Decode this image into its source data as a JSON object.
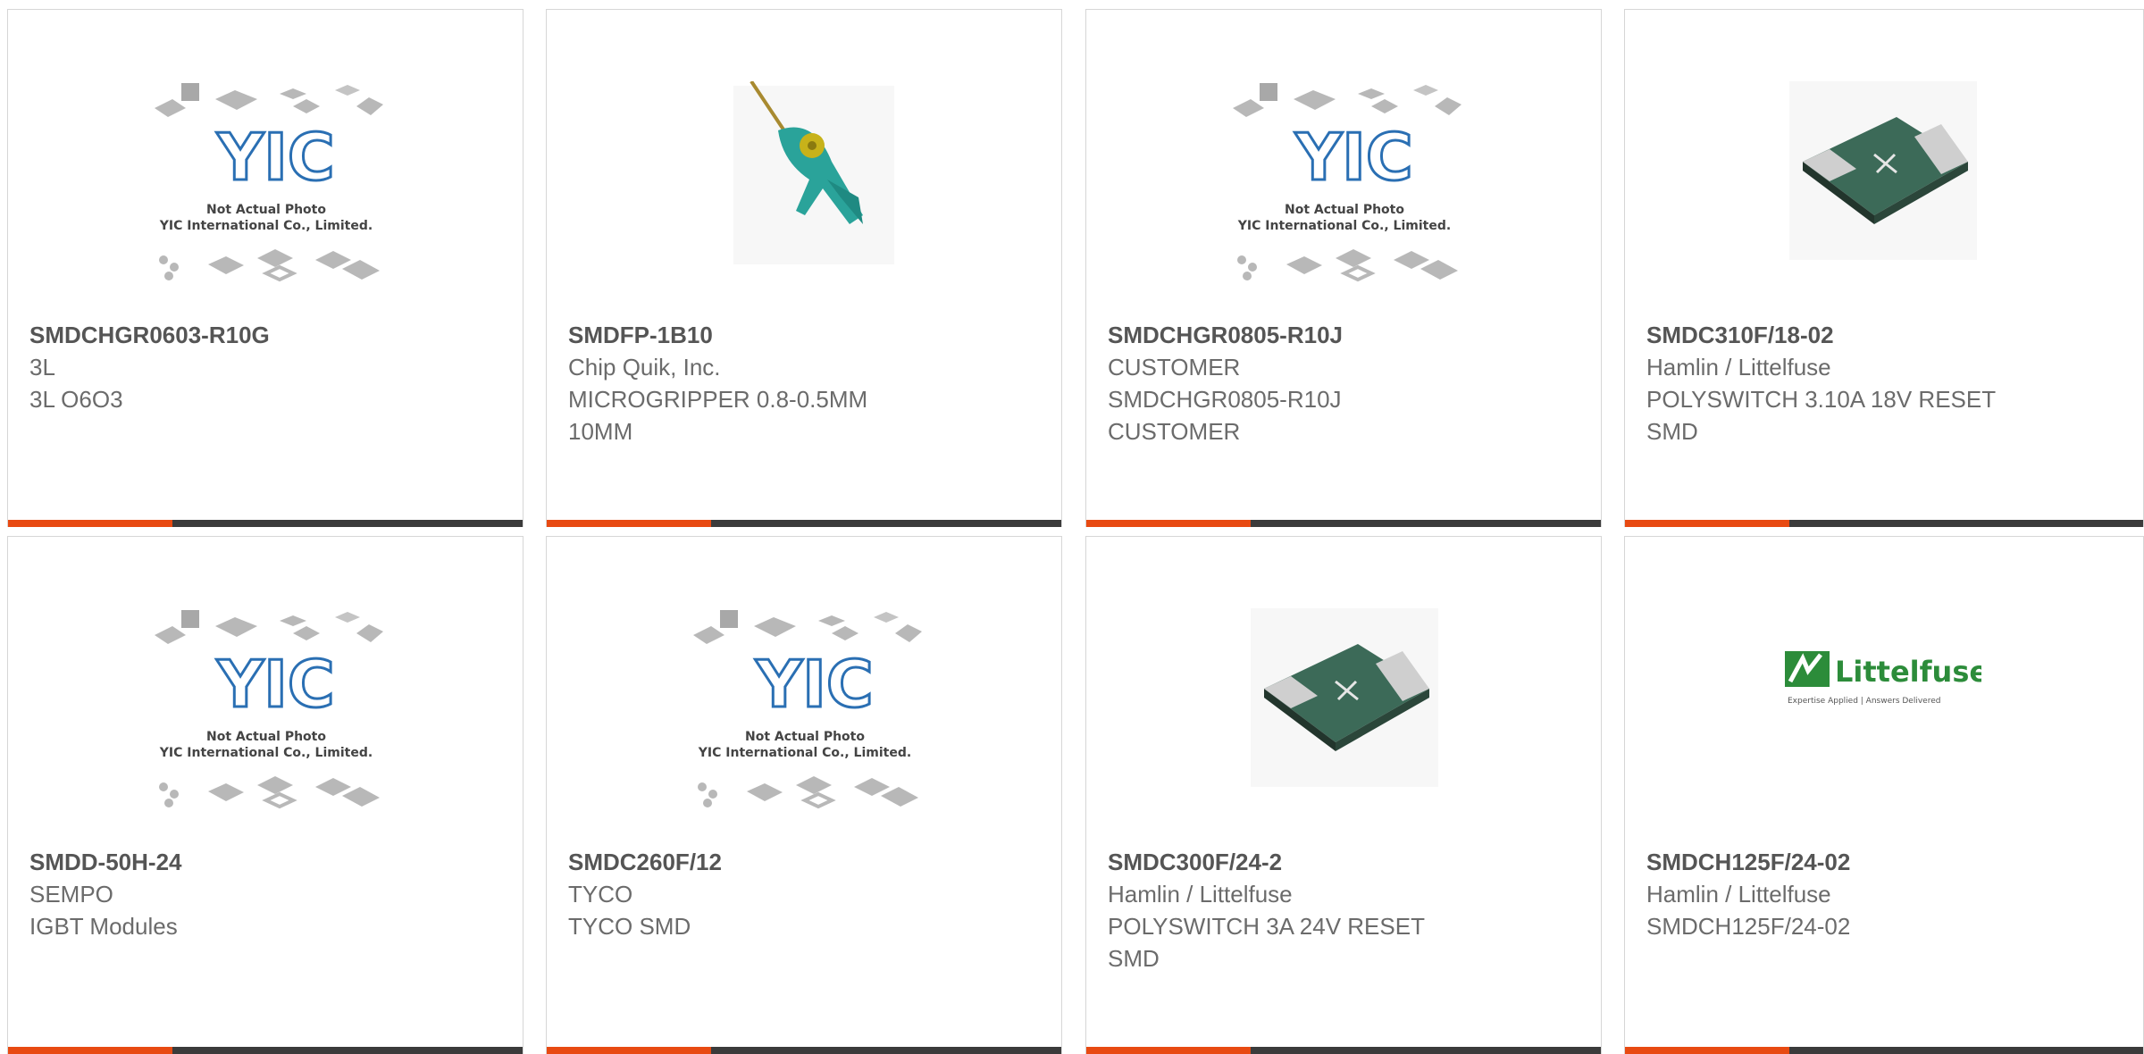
{
  "colors": {
    "accent": "#e84a12",
    "bar": "#3b3b3b",
    "border": "#d6d6d6",
    "text": "#666666"
  },
  "products": [
    {
      "part_number": "SMDCHGR0603-R10G",
      "manufacturer": "3L",
      "description": "3L O6O3",
      "image": "yic-placeholder",
      "placeholder_text": [
        "Not Actual Photo",
        "YIC International Co., Limited."
      ]
    },
    {
      "part_number": "SMDFP-1B10",
      "manufacturer": "Chip Quik, Inc.",
      "description": "MICROGRIPPER 0.8-0.5MM 10MM",
      "image": "microgripper-photo"
    },
    {
      "part_number": "SMDCHGR0805-R10J",
      "manufacturer": "CUSTOMER",
      "description": "SMDCHGR0805-R10J CUSTOMER",
      "image": "yic-placeholder",
      "placeholder_text": [
        "Not Actual Photo",
        "YIC International Co., Limited."
      ]
    },
    {
      "part_number": "SMDC310F/18-02",
      "manufacturer": "Hamlin / Littelfuse",
      "description": "POLYSWITCH 3.10A 18V RESET SMD",
      "image": "polyswitch-photo"
    },
    {
      "part_number": "SMDD-50H-24",
      "manufacturer": "SEMPO",
      "description": "IGBT Modules",
      "image": "yic-placeholder",
      "placeholder_text": [
        "Not Actual Photo",
        "YIC International Co., Limited."
      ]
    },
    {
      "part_number": "SMDC260F/12",
      "manufacturer": "TYCO",
      "description": "TYCO SMD",
      "image": "yic-placeholder",
      "placeholder_text": [
        "Not Actual Photo",
        "YIC International Co., Limited."
      ]
    },
    {
      "part_number": "SMDC300F/24-2",
      "manufacturer": "Hamlin / Littelfuse",
      "description": "POLYSWITCH 3A 24V RESET SMD",
      "image": "polyswitch-photo"
    },
    {
      "part_number": "SMDCH125F/24-02",
      "manufacturer": "Hamlin / Littelfuse",
      "description": "SMDCH125F/24-02",
      "image": "littelfuse-logo",
      "logo_text": [
        "Littelfuse",
        "Expertise Applied | Answers Delivered"
      ]
    }
  ]
}
